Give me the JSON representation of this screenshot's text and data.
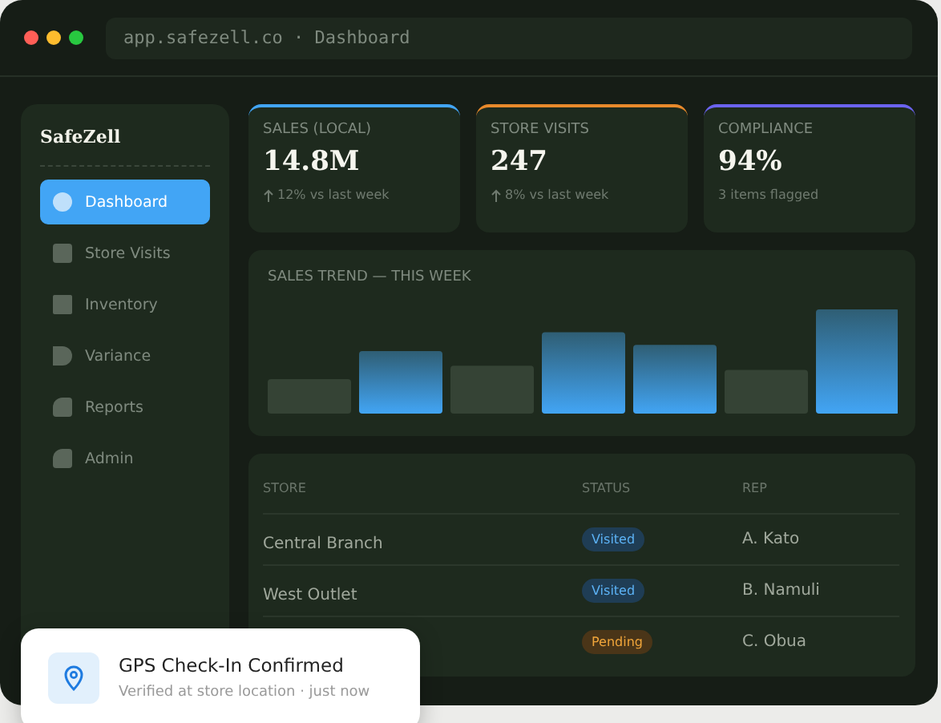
{
  "window": {
    "address": "app.safezell.co · Dashboard"
  },
  "sidebar": {
    "brand": "SafeZell",
    "items": [
      {
        "label": "Dashboard",
        "selected": true
      },
      {
        "label": "Store Visits",
        "selected": false
      },
      {
        "label": "Inventory",
        "selected": false
      },
      {
        "label": "Variance",
        "selected": false
      },
      {
        "label": "Reports",
        "selected": false
      },
      {
        "label": "Admin",
        "selected": false
      }
    ]
  },
  "cards": [
    {
      "title": "SALES (LOCAL)",
      "value": "14.8M",
      "note": "12% vs last week",
      "rising": true,
      "color": "#42a5f5"
    },
    {
      "title": "STORE VISITS",
      "value": "247",
      "note": "8% vs last week",
      "rising": true,
      "color": "#e8892b"
    },
    {
      "title": "COMPLIANCE",
      "value": "94%",
      "note": "3 items flagged",
      "rising": false,
      "color": "#6b63f0"
    }
  ],
  "chart": {
    "title": "SALES TREND — THIS WEEK"
  },
  "table": {
    "columns": [
      "STORE",
      "STATUS",
      "REP"
    ],
    "rows": [
      {
        "store": "Central Branch",
        "status": "Visited",
        "kind": "visited",
        "rep": "A. Kato"
      },
      {
        "store": "West Outlet",
        "status": "Visited",
        "kind": "visited",
        "rep": "B. Namuli"
      },
      {
        "status": "Pending",
        "kind": "pending",
        "rep": "C. Obua"
      }
    ]
  },
  "toast": {
    "title": "GPS Check-In Confirmed",
    "message": "Verified at store location · just now"
  }
}
